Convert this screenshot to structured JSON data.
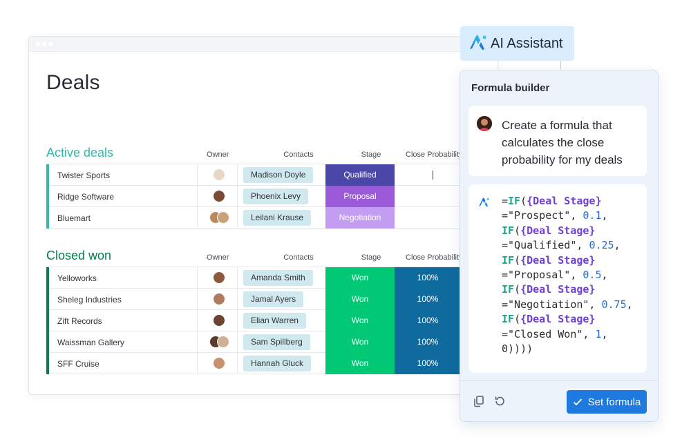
{
  "board": {
    "title": "Deals",
    "columns": {
      "owner": "Owner",
      "contacts": "Contacts",
      "stage": "Stage",
      "probability": "Close Probability"
    }
  },
  "groups": {
    "active": {
      "title": "Active deals",
      "rows": [
        {
          "name": "Twister Sports",
          "contact": "Madison Doyle",
          "stage": "Qualified",
          "stage_color": "#4b47a8",
          "probability": ""
        },
        {
          "name": "Ridge Software",
          "contact": "Phoenix Levy",
          "stage": "Proposal",
          "stage_color": "#9b5ad8",
          "probability": ""
        },
        {
          "name": "Bluemart",
          "contact": "Leilani Krause",
          "stage": "Negotiation",
          "stage_color": "#c39df2",
          "probability": ""
        }
      ]
    },
    "won": {
      "title": "Closed won",
      "rows": [
        {
          "name": "Yelloworks",
          "contact": "Amanda Smith",
          "stage": "Won",
          "stage_color": "#00c875",
          "probability": "100%"
        },
        {
          "name": "Sheleg Industries",
          "contact": "Jamal Ayers",
          "stage": "Won",
          "stage_color": "#00c875",
          "probability": "100%"
        },
        {
          "name": "Zift Records",
          "contact": "Elian Warren",
          "stage": "Won",
          "stage_color": "#00c875",
          "probability": "100%"
        },
        {
          "name": "Waissman Gallery",
          "contact": "Sam Spillberg",
          "stage": "Won",
          "stage_color": "#00c875",
          "probability": "100%"
        },
        {
          "name": "SFF Cruise",
          "contact": "Hannah Gluck",
          "stage": "Won",
          "stage_color": "#00c875",
          "probability": "100%"
        }
      ]
    }
  },
  "assistant": {
    "badge_label": "AI Assistant",
    "panel_title": "Formula builder",
    "prompt": "Create a formula that calculates the close probability for my deals",
    "formula_lines": [
      "=IF({Deal Stage}",
      "=\"Prospect\", 0.1,",
      "IF({Deal Stage}",
      "=\"Qualified\", 0.25,",
      "IF({Deal Stage}",
      "=\"Proposal\", 0.5,",
      "IF({Deal Stage}",
      "=\"Negotiation\", 0.75,",
      "IF({Deal Stage}",
      "=\"Closed Won\", 1,",
      "0))))"
    ],
    "set_button_label": "Set formula",
    "copy_icon": "copy-icon",
    "undo_icon": "undo-icon"
  },
  "colors": {
    "active_group": "#33b9a9",
    "won_group": "#037f4c",
    "probability_fill": "#0f6a9e",
    "primary_button": "#1f7ae0"
  }
}
